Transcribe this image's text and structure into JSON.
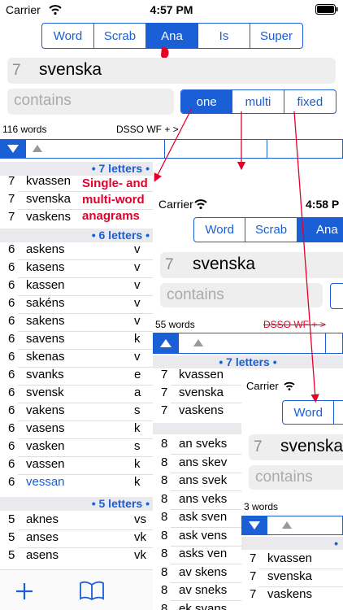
{
  "screen1": {
    "status": {
      "carrier": "Carrier",
      "time": "4:57 PM"
    },
    "tabs": [
      "Word",
      "Scrab",
      "Ana",
      "Is",
      "Super"
    ],
    "active_tab": "Ana",
    "input": {
      "length": "7",
      "word": "svenska"
    },
    "contains_placeholder": "contains",
    "mode_tabs": [
      "one",
      "multi",
      "fixed"
    ],
    "active_mode": "one",
    "word_count": "116 words",
    "header_right": "DSSO  WF + >",
    "annotation": "Single- and multi-word anagrams",
    "sections": [
      {
        "label": "• 7 letters •",
        "rows": [
          {
            "len": "7",
            "word": "kvassen",
            "extra": ""
          },
          {
            "len": "7",
            "word": "svenska",
            "extra": ""
          },
          {
            "len": "7",
            "word": "vaskens",
            "extra": ""
          }
        ]
      },
      {
        "label": "• 6 letters •",
        "rows": [
          {
            "len": "6",
            "word": "askens",
            "extra": "v"
          },
          {
            "len": "6",
            "word": "kasens",
            "extra": "v"
          },
          {
            "len": "6",
            "word": "kassen",
            "extra": "v"
          },
          {
            "len": "6",
            "word": "sakéns",
            "extra": "v"
          },
          {
            "len": "6",
            "word": "sakens",
            "extra": "v"
          },
          {
            "len": "6",
            "word": "savens",
            "extra": "k"
          },
          {
            "len": "6",
            "word": "skenas",
            "extra": "v"
          },
          {
            "len": "6",
            "word": "svanks",
            "extra": "e"
          },
          {
            "len": "6",
            "word": "svensk",
            "extra": "a"
          },
          {
            "len": "6",
            "word": "vakens",
            "extra": "s"
          },
          {
            "len": "6",
            "word": "vasens",
            "extra": "k"
          },
          {
            "len": "6",
            "word": "vasken",
            "extra": "s"
          },
          {
            "len": "6",
            "word": "vassen",
            "extra": "k"
          },
          {
            "len": "6",
            "word": "vessan",
            "extra": "k"
          }
        ]
      },
      {
        "label": "• 5 letters •",
        "rows": [
          {
            "len": "5",
            "word": "aknes",
            "extra": "vs"
          },
          {
            "len": "5",
            "word": "anses",
            "extra": "vk"
          },
          {
            "len": "5",
            "word": "asens",
            "extra": "vk"
          }
        ]
      }
    ],
    "toolbar": {
      "add": "+",
      "book": "book"
    }
  },
  "screen2": {
    "status": {
      "carrier": "Carrier",
      "time": "4:58 P"
    },
    "tabs": [
      "Word",
      "Scrab",
      "Ana"
    ],
    "active_tab": "Ana",
    "input": {
      "length": "7",
      "word": "svenska"
    },
    "contains_placeholder": "contains",
    "word_count": "55 words",
    "header_right": "DSSO  WF  + >",
    "section_label": "• 7 letters •",
    "rows7": [
      {
        "len": "7",
        "word": "kvassen"
      },
      {
        "len": "7",
        "word": "svenska"
      },
      {
        "len": "7",
        "word": "vaskens"
      }
    ],
    "rows8": [
      {
        "len": "8",
        "word": "an sveks"
      },
      {
        "len": "8",
        "word": "ans skev"
      },
      {
        "len": "8",
        "word": "ans svek"
      },
      {
        "len": "8",
        "word": "ans veks"
      },
      {
        "len": "8",
        "word": "ask sven"
      },
      {
        "len": "8",
        "word": "ask vens"
      },
      {
        "len": "8",
        "word": "asks ven"
      },
      {
        "len": "8",
        "word": "av skens"
      },
      {
        "len": "8",
        "word": "av sneks"
      },
      {
        "len": "8",
        "word": "ek svans"
      }
    ]
  },
  "screen3": {
    "status": {
      "carrier": "Carrier"
    },
    "tabs": [
      "Word"
    ],
    "input": {
      "length": "7",
      "word": "svenska"
    },
    "contains_placeholder": "contains",
    "word_count": "3 words",
    "rows": [
      {
        "len": "7",
        "word": "kvassen"
      },
      {
        "len": "7",
        "word": "svenska"
      },
      {
        "len": "7",
        "word": "vaskens"
      }
    ]
  },
  "colors": {
    "accent": "#1a5fd6",
    "annotation": "#e5002a"
  },
  "icons": {
    "wifi": "wifi-icon",
    "battery": "battery-icon",
    "triangle": "sort-triangle-icon",
    "add": "add-icon",
    "book": "book-icon"
  }
}
